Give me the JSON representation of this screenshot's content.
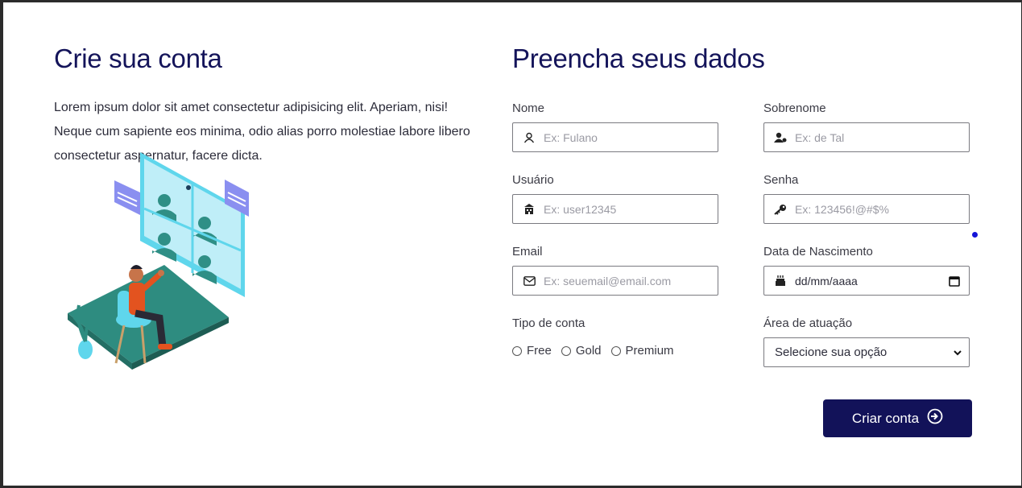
{
  "left": {
    "title": "Crie sua conta",
    "intro": "Lorem ipsum dolor sit amet consectetur adipisicing elit. Aperiam, nisi! Neque cum sapiente eos minima, odio alias porro molestiae labore libero consectetur aspernatur, facere dicta."
  },
  "form": {
    "title": "Preencha seus dados",
    "nome": {
      "label": "Nome",
      "placeholder": "Ex: Fulano",
      "icon": "user-outline-icon"
    },
    "sobrenome": {
      "label": "Sobrenome",
      "placeholder": "Ex: de Tal",
      "icon": "user-tag-icon"
    },
    "usuario": {
      "label": "Usuário",
      "placeholder": "Ex: user12345",
      "icon": "building-icon"
    },
    "senha": {
      "label": "Senha",
      "placeholder": "Ex: 123456!@#$%",
      "icon": "key-icon"
    },
    "email": {
      "label": "Email",
      "placeholder": "Ex: seuemail@email.com",
      "icon": "envelope-icon"
    },
    "nascimento": {
      "label": "Data de Nascimento",
      "value": "dd/mm/aaaa",
      "icon": "cake-icon"
    },
    "tipo": {
      "label": "Tipo de conta",
      "options": [
        "Free",
        "Gold",
        "Premium"
      ]
    },
    "area": {
      "label": "Área de atuação",
      "selected": "Selecione sua opção"
    },
    "submit": {
      "label": "Criar conta"
    }
  },
  "colors": {
    "primary": "#121259",
    "accent_dot": "#1414d8"
  }
}
